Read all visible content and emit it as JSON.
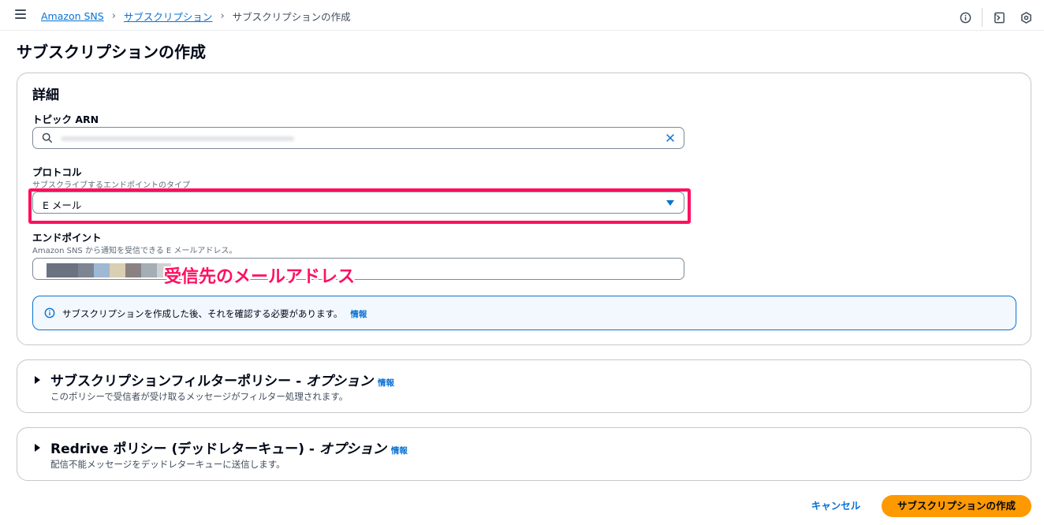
{
  "breadcrumbs": {
    "items": [
      "Amazon SNS",
      "サブスクリプション"
    ],
    "current": "サブスクリプションの作成"
  },
  "page_title": "サブスクリプションの作成",
  "details": {
    "heading": "詳細",
    "topic_arn": {
      "label": "トピック ARN",
      "value_obscured": true
    },
    "protocol": {
      "label": "プロトコル",
      "description": "サブスクライブするエンドポイントのタイプ",
      "selected": "E メール"
    },
    "endpoint": {
      "label": "エンドポイント",
      "description": "Amazon SNS から通知を受信できる E メールアドレス。",
      "value_obscured": true,
      "swatch_colors": [
        "#6b7280",
        "#7d8593",
        "#9fb8d4",
        "#d9cfb2",
        "#8a8282",
        "#a3aeb5",
        "#cfd1d3"
      ]
    },
    "info_alert": {
      "text": "サブスクリプションを作成した後、それを確認する必要があります。",
      "link": "情報"
    }
  },
  "annotation": "受信先のメールアドレス",
  "filter_policy": {
    "title": "サブスクリプションフィルターポリシー - ",
    "optional": "オプション",
    "info": "情報",
    "description": "このポリシーで受信者が受け取るメッセージがフィルター処理されます。"
  },
  "redrive_policy": {
    "title": "Redrive ポリシー (デッドレターキュー) - ",
    "optional": "オプション",
    "info": "情報",
    "description": "配信不能メッセージをデッドレターキューに送信します。"
  },
  "actions": {
    "cancel": "キャンセル",
    "create": "サブスクリプションの作成"
  },
  "colors": {
    "link": "#0972d3",
    "primary_button": "#ff9900",
    "annotation": "#ff0f5f"
  }
}
